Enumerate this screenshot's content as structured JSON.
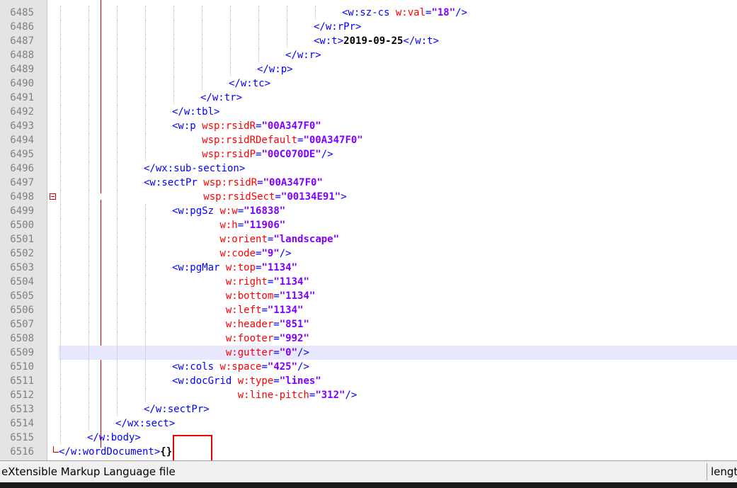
{
  "editor": {
    "lines": [
      {
        "n": "6485",
        "indent": 10,
        "tokens": [
          [
            "tag",
            "<w:sz-cs "
          ],
          [
            "attr",
            "w:val"
          ],
          [
            "tag",
            "="
          ],
          [
            "val",
            "\"18\""
          ],
          [
            "tag",
            "/>"
          ]
        ]
      },
      {
        "n": "6486",
        "indent": 9,
        "tokens": [
          [
            "tag",
            "</w:rPr>"
          ]
        ]
      },
      {
        "n": "6487",
        "indent": 9,
        "tokens": [
          [
            "tag",
            "<w:t>"
          ],
          [
            "txt",
            "2019-09-25"
          ],
          [
            "tag",
            "</w:t>"
          ]
        ]
      },
      {
        "n": "6488",
        "indent": 8,
        "tokens": [
          [
            "tag",
            "</w:r>"
          ]
        ]
      },
      {
        "n": "6489",
        "indent": 7,
        "tokens": [
          [
            "tag",
            "</w:p>"
          ]
        ]
      },
      {
        "n": "6490",
        "indent": 6,
        "tokens": [
          [
            "tag",
            "</w:tc>"
          ]
        ]
      },
      {
        "n": "6491",
        "indent": 5,
        "tokens": [
          [
            "tag",
            "</w:tr>"
          ]
        ]
      },
      {
        "n": "6492",
        "indent": 4,
        "tokens": [
          [
            "tag",
            "</w:tbl>"
          ]
        ]
      },
      {
        "n": "6493",
        "indent": 4,
        "tokens": [
          [
            "tag",
            "<w:p "
          ],
          [
            "attr",
            "wsp:rsidR"
          ],
          [
            "tag",
            "="
          ],
          [
            "val",
            "\"00A347F0\""
          ]
        ]
      },
      {
        "n": "6494",
        "indent": 4,
        "pad": 5,
        "tokens": [
          [
            "attr",
            "wsp:rsidRDefault"
          ],
          [
            "tag",
            "="
          ],
          [
            "val",
            "\"00A347F0\""
          ]
        ]
      },
      {
        "n": "6495",
        "indent": 4,
        "pad": 5,
        "tokens": [
          [
            "attr",
            "wsp:rsidP"
          ],
          [
            "tag",
            "="
          ],
          [
            "val",
            "\"00C070DE\""
          ],
          [
            "tag",
            "/>"
          ]
        ]
      },
      {
        "n": "6496",
        "indent": 3,
        "tokens": [
          [
            "tag",
            "</wx:sub-section>"
          ]
        ]
      },
      {
        "n": "6497",
        "indent": 3,
        "tokens": [
          [
            "tag",
            "<w:sectPr "
          ],
          [
            "attr",
            "wsp:rsidR"
          ],
          [
            "tag",
            "="
          ],
          [
            "val",
            "\"00A347F0\""
          ]
        ]
      },
      {
        "n": "6498",
        "indent": 3,
        "pad": 10,
        "tokens": [
          [
            "attr",
            "wsp:rsidSect"
          ],
          [
            "tag",
            "="
          ],
          [
            "val",
            "\"00134E91\""
          ],
          [
            "tag",
            ">"
          ]
        ]
      },
      {
        "n": "6499",
        "indent": 4,
        "tokens": [
          [
            "tag",
            "<w:pgSz "
          ],
          [
            "attr",
            "w:w"
          ],
          [
            "tag",
            "="
          ],
          [
            "val",
            "\"16838\""
          ]
        ]
      },
      {
        "n": "6500",
        "indent": 4,
        "pad": 8,
        "tokens": [
          [
            "attr",
            "w:h"
          ],
          [
            "tag",
            "="
          ],
          [
            "val",
            "\"11906\""
          ]
        ]
      },
      {
        "n": "6501",
        "indent": 4,
        "pad": 8,
        "tokens": [
          [
            "attr",
            "w:orient"
          ],
          [
            "tag",
            "="
          ],
          [
            "val",
            "\"landscape\""
          ]
        ]
      },
      {
        "n": "6502",
        "indent": 4,
        "pad": 8,
        "tokens": [
          [
            "attr",
            "w:code"
          ],
          [
            "tag",
            "="
          ],
          [
            "val",
            "\"9\""
          ],
          [
            "tag",
            "/>"
          ]
        ]
      },
      {
        "n": "6503",
        "indent": 4,
        "tokens": [
          [
            "tag",
            "<w:pgMar "
          ],
          [
            "attr",
            "w:top"
          ],
          [
            "tag",
            "="
          ],
          [
            "val",
            "\"1134\""
          ]
        ]
      },
      {
        "n": "6504",
        "indent": 4,
        "pad": 9,
        "tokens": [
          [
            "attr",
            "w:right"
          ],
          [
            "tag",
            "="
          ],
          [
            "val",
            "\"1134\""
          ]
        ]
      },
      {
        "n": "6505",
        "indent": 4,
        "pad": 9,
        "tokens": [
          [
            "attr",
            "w:bottom"
          ],
          [
            "tag",
            "="
          ],
          [
            "val",
            "\"1134\""
          ]
        ]
      },
      {
        "n": "6506",
        "indent": 4,
        "pad": 9,
        "tokens": [
          [
            "attr",
            "w:left"
          ],
          [
            "tag",
            "="
          ],
          [
            "val",
            "\"1134\""
          ]
        ]
      },
      {
        "n": "6507",
        "indent": 4,
        "pad": 9,
        "tokens": [
          [
            "attr",
            "w:header"
          ],
          [
            "tag",
            "="
          ],
          [
            "val",
            "\"851\""
          ]
        ]
      },
      {
        "n": "6508",
        "indent": 4,
        "pad": 9,
        "tokens": [
          [
            "attr",
            "w:footer"
          ],
          [
            "tag",
            "="
          ],
          [
            "val",
            "\"992\""
          ]
        ]
      },
      {
        "n": "6509",
        "indent": 4,
        "pad": 9,
        "highlight": true,
        "tokens": [
          [
            "attr",
            "w:gutter"
          ],
          [
            "tag",
            "="
          ],
          [
            "val",
            "\"0\""
          ],
          [
            "tag",
            "/>"
          ]
        ]
      },
      {
        "n": "6510",
        "indent": 4,
        "tokens": [
          [
            "tag",
            "<w:cols "
          ],
          [
            "attr",
            "w:space"
          ],
          [
            "tag",
            "="
          ],
          [
            "val",
            "\"425\""
          ],
          [
            "tag",
            "/>"
          ]
        ]
      },
      {
        "n": "6511",
        "indent": 4,
        "tokens": [
          [
            "tag",
            "<w:docGrid "
          ],
          [
            "attr",
            "w:type"
          ],
          [
            "tag",
            "="
          ],
          [
            "val",
            "\"lines\""
          ]
        ]
      },
      {
        "n": "6512",
        "indent": 4,
        "pad": 11,
        "tokens": [
          [
            "attr",
            "w:line-pitch"
          ],
          [
            "tag",
            "="
          ],
          [
            "val",
            "\"312\""
          ],
          [
            "tag",
            "/>"
          ]
        ]
      },
      {
        "n": "6513",
        "indent": 3,
        "tokens": [
          [
            "tag",
            "</w:sectPr>"
          ]
        ]
      },
      {
        "n": "6514",
        "indent": 2,
        "tokens": [
          [
            "tag",
            "</wx:sect>"
          ]
        ]
      },
      {
        "n": "6515",
        "indent": 1,
        "tokens": [
          [
            "tag",
            "</w:body>"
          ]
        ]
      },
      {
        "n": "6516",
        "indent": 0,
        "tokens": [
          [
            "tag",
            "</w:wordDocument>"
          ],
          [
            "brace",
            "{}"
          ]
        ]
      }
    ]
  },
  "statusbar": {
    "file_type": "eXtensible Markup Language file",
    "length_label": "lengt"
  },
  "colors": {
    "tag": "#0000ff",
    "attr": "#ff0000",
    "value": "#8000ff",
    "highlight": "#e8e8ff",
    "annotation_box": "#e60000"
  }
}
